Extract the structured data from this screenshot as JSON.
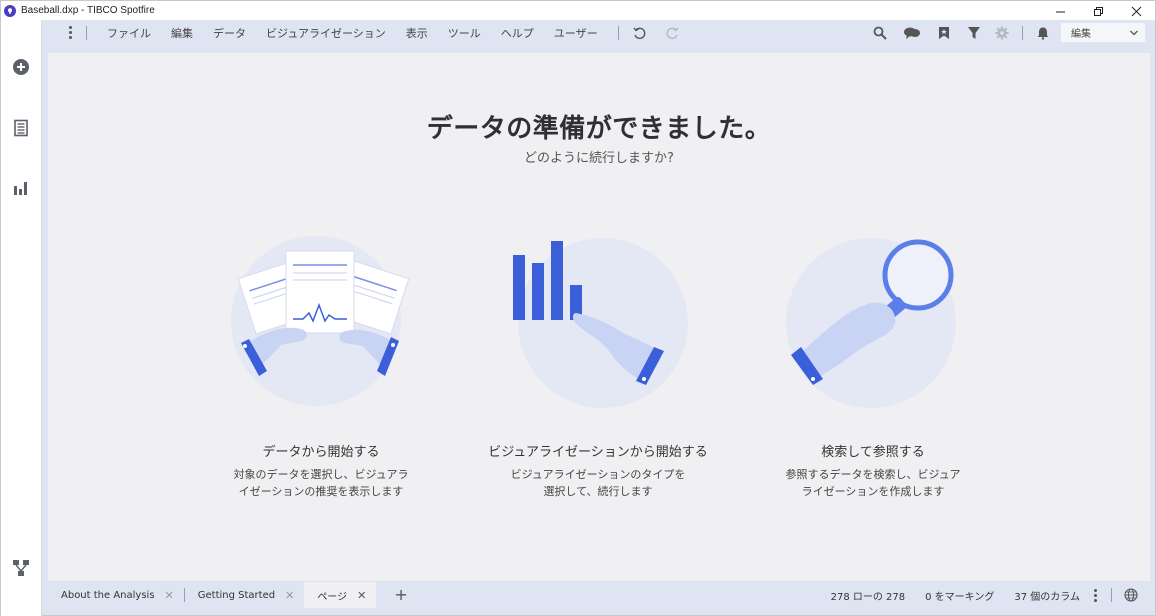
{
  "window": {
    "title": "Baseball.dxp - TIBCO Spotfire"
  },
  "menu": {
    "items": [
      "ファイル",
      "編集",
      "データ",
      "ビジュアライゼーション",
      "表示",
      "ツール",
      "ヘルプ",
      "ユーザー"
    ]
  },
  "toolbar": {
    "mode_label": "編集",
    "icons": [
      "undo-icon",
      "redo-icon",
      "search-icon",
      "comments-icon",
      "bookmark-icon",
      "filter-icon",
      "settings-icon",
      "notification-bell-icon"
    ]
  },
  "left_rail": {
    "icons": [
      "add-icon",
      "data-panel-icon",
      "visualization-panel-icon",
      "data-canvas-icon"
    ]
  },
  "welcome": {
    "headline": "データの準備ができました。",
    "subline": "どのように続行しますか?",
    "options": [
      {
        "title": "データから開始する",
        "desc_line1": "対象のデータを選択し、ビジュアラ",
        "desc_line2": "イゼーションの推奨を表示します"
      },
      {
        "title": "ビジュアライゼーションから開始する",
        "desc_line1": "ビジュアライゼーションのタイプを",
        "desc_line2": "選択して、続行します"
      },
      {
        "title": "検索して参照する",
        "desc_line1": "参照するデータを検索し、ビジュア",
        "desc_line2": "ライゼーションを作成します"
      }
    ]
  },
  "tabs": [
    {
      "label": "About the Analysis",
      "active": false
    },
    {
      "label": "Getting Started",
      "active": false
    },
    {
      "label": "ページ",
      "active": true
    }
  ],
  "status": {
    "rows": "278 ローの 278",
    "marked": "0 をマーキング",
    "columns": "37 個のカラム"
  },
  "colors": {
    "accent_blue": "#3a5fd9",
    "light_blue": "#dfe4f3",
    "canvas_bg": "#f0f0f2",
    "illus_circle": "#e4e8f5"
  }
}
